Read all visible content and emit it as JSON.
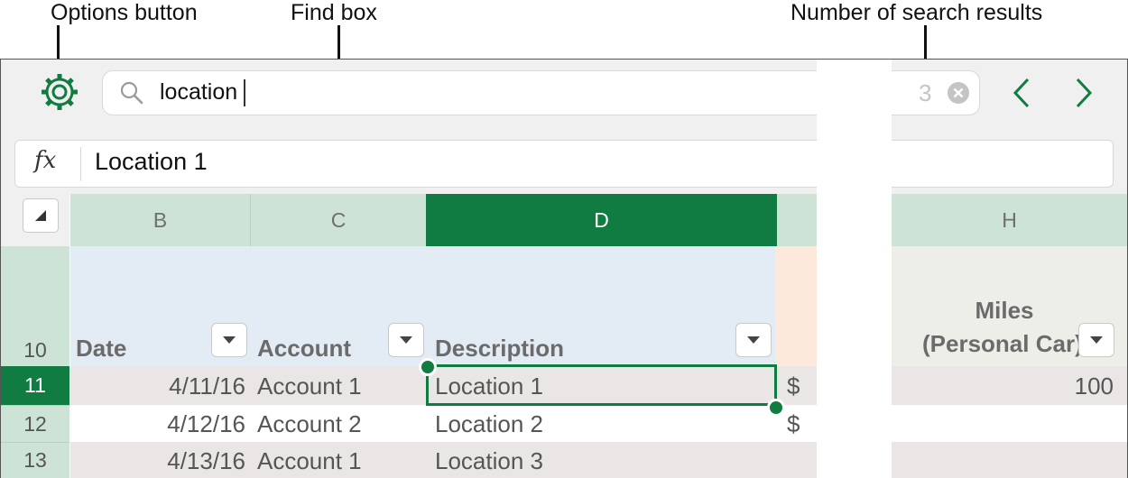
{
  "callouts": {
    "options": "Options button",
    "find": "Find box",
    "results": "Number of search results"
  },
  "find": {
    "query": "location",
    "result_count": "3"
  },
  "formula_bar": {
    "fx_label": "fx",
    "content": "Location 1"
  },
  "columns": [
    "B",
    "C",
    "D",
    "H"
  ],
  "header_row": {
    "row_number": "10",
    "date": "Date",
    "account": "Account",
    "description": "Description",
    "miles_line1": "Miles",
    "miles_line2": "(Personal Car)"
  },
  "rows": [
    {
      "row": "11",
      "date": "4/11/16",
      "account": "Account 1",
      "description": "Location 1",
      "currency": "$",
      "miles": "100"
    },
    {
      "row": "12",
      "date": "4/12/16",
      "account": "Account 2",
      "description": "Location 2",
      "currency": "$",
      "miles": ""
    },
    {
      "row": "13",
      "date": "4/13/16",
      "account": "Account 1",
      "description": "Location 3",
      "currency": "",
      "miles": ""
    }
  ],
  "colors": {
    "accent": "#107c41",
    "header_bg": "#cde3d6",
    "table_header_bg": "#e3ecf4",
    "peach": "#fde8dc",
    "miles_header_bg": "#eeeee8"
  },
  "icons": [
    "gear-icon",
    "search-icon",
    "clear-icon",
    "chevron-left-icon",
    "chevron-right-icon",
    "select-all-icon",
    "filter-dropdown-icon"
  ]
}
